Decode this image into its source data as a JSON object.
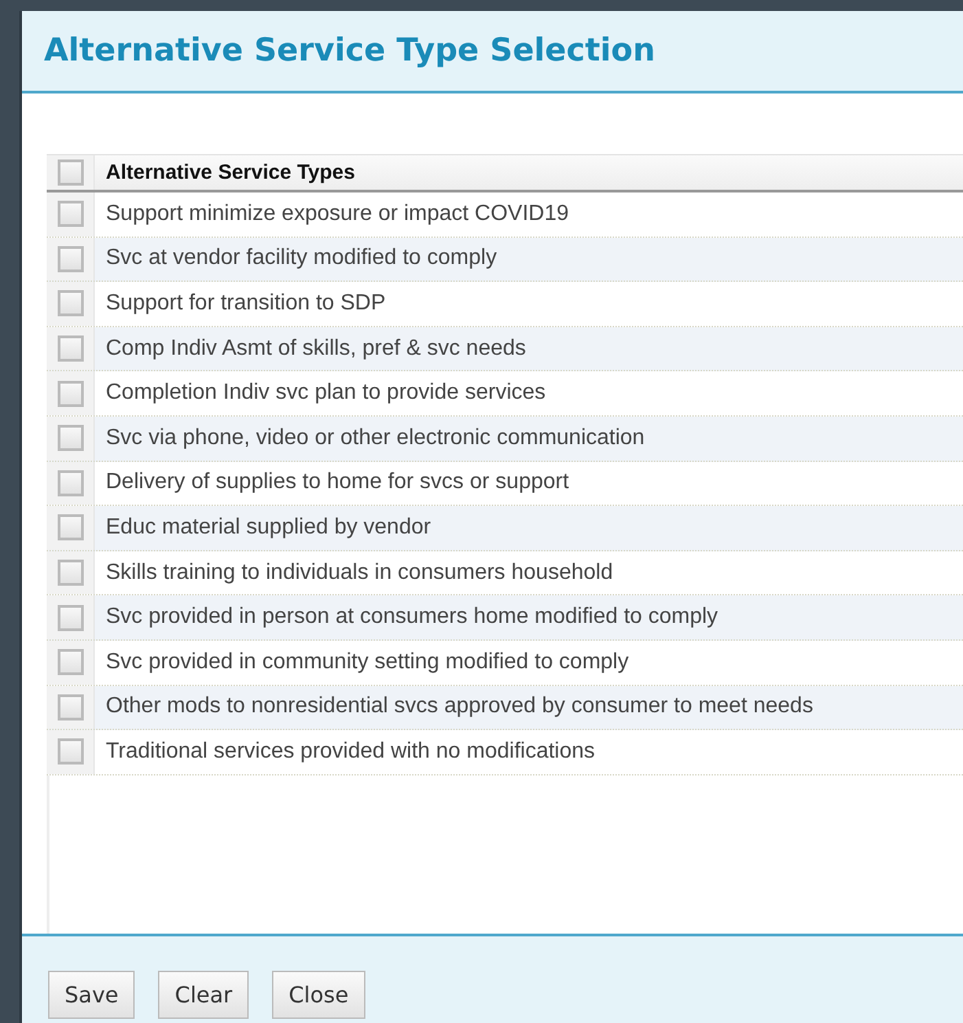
{
  "dialog": {
    "title": "Alternative Service Type Selection"
  },
  "table": {
    "select_all": {
      "checked": false
    },
    "columns": [
      "Alternative Service Types"
    ],
    "rows": [
      {
        "label": "Support minimize exposure or impact COVID19",
        "checked": false
      },
      {
        "label": "Svc at vendor facility modified to comply",
        "checked": false
      },
      {
        "label": "Support for transition to SDP",
        "checked": false
      },
      {
        "label": "Comp Indiv Asmt of skills, pref & svc needs",
        "checked": false
      },
      {
        "label": "Completion Indiv svc plan to provide services",
        "checked": false
      },
      {
        "label": "Svc via phone, video or other electronic communication",
        "checked": false
      },
      {
        "label": "Delivery of supplies to home for svcs or support",
        "checked": false
      },
      {
        "label": "Educ material supplied by vendor",
        "checked": false
      },
      {
        "label": "Skills training to individuals in consumers household",
        "checked": false
      },
      {
        "label": "Svc provided in person at consumers home modified to comply",
        "checked": false
      },
      {
        "label": "Svc provided in community setting modified to comply",
        "checked": false
      },
      {
        "label": "Other mods to nonresidential svcs approved by consumer to meet needs",
        "checked": false
      },
      {
        "label": "Traditional services provided with no modifications",
        "checked": false
      }
    ]
  },
  "buttons": [
    "Save",
    "Clear",
    "Close"
  ]
}
